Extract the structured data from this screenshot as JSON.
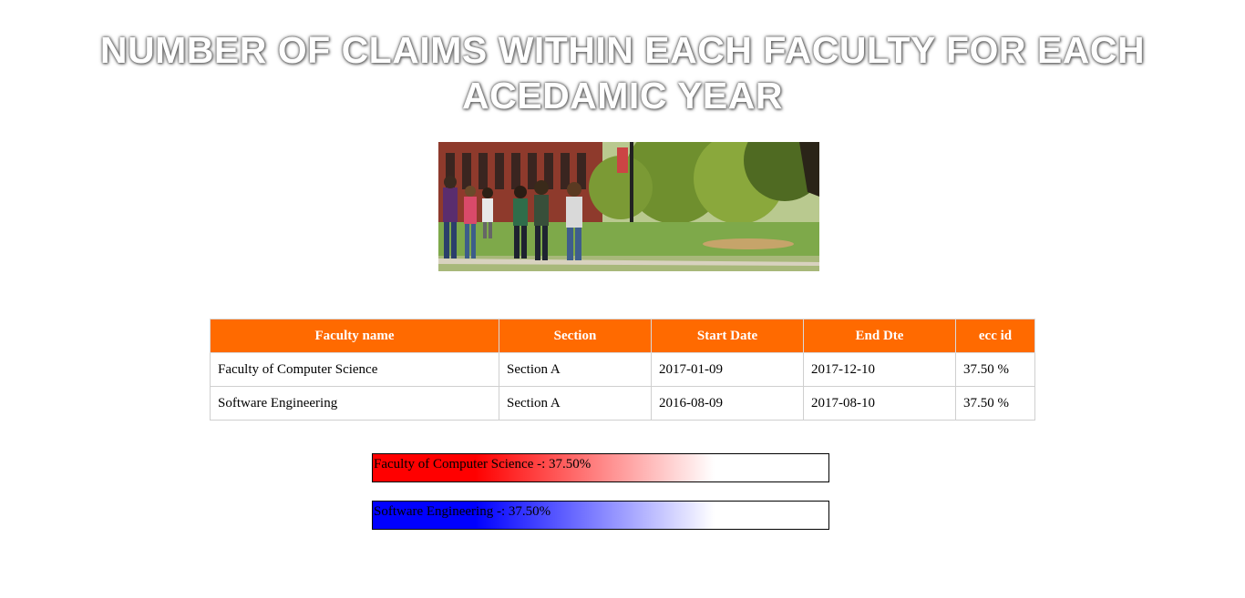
{
  "page": {
    "title": "NUMBER OF CLAIMS WITHIN EACH FACULTY FOR EACH ACEDAMIC YEAR"
  },
  "table": {
    "headers": [
      "Faculty name",
      "Section",
      "Start Date",
      "End Dte",
      "ecc id"
    ],
    "rows": [
      [
        "Faculty of Computer Science",
        "Section A",
        "2017-01-09",
        "2017-12-10",
        "37.50 %"
      ],
      [
        "Software Engineering",
        "Section A",
        "2016-08-09",
        "2017-08-10",
        "37.50 %"
      ]
    ],
    "header_color": "#ff6a00"
  },
  "bars": [
    {
      "label": "Faculty of Computer Science -: 37.50%",
      "percent": 75,
      "color": "#ff0000"
    },
    {
      "label": "Software Engineering -: 37.50%",
      "percent": 75,
      "color": "#0000ff"
    }
  ]
}
